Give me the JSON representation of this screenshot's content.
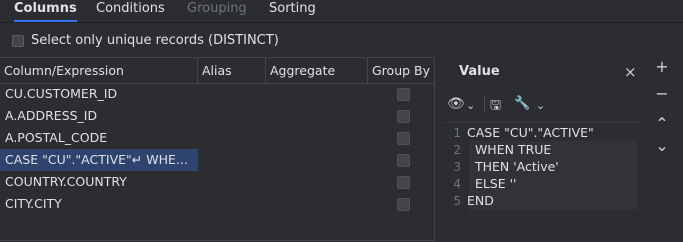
{
  "tabs": [
    {
      "label": "Columns",
      "state": "active"
    },
    {
      "label": "Conditions",
      "state": "normal"
    },
    {
      "label": "Grouping",
      "state": "disabled"
    },
    {
      "label": "Sorting",
      "state": "normal"
    }
  ],
  "distinct": {
    "label": "Select only unique records (DISTINCT)",
    "checked": false
  },
  "grid": {
    "headers": [
      "Column/Expression",
      "Alias",
      "Aggregate",
      "Group By"
    ],
    "rows": [
      {
        "expression": "CU.CUSTOMER_ID",
        "selected": false
      },
      {
        "expression": "A.ADDRESS_ID",
        "selected": false
      },
      {
        "expression": "A.POSTAL_CODE",
        "selected": false
      },
      {
        "expression": "CASE \"CU\".\"ACTIVE\"↵   WHE...",
        "selected": true
      },
      {
        "expression": "COUNTRY.COUNTRY",
        "selected": false
      },
      {
        "expression": "CITY.CITY",
        "selected": false
      }
    ]
  },
  "value_panel": {
    "title": "Value",
    "close_icon": "×",
    "toolbar": {
      "eye_icon": "👁",
      "chevron": "⌄",
      "save_icon": "🖫",
      "wrench_icon": "🔧"
    },
    "lines": [
      {
        "num": "1",
        "text": "CASE \"CU\".\"ACTIVE\""
      },
      {
        "num": "2",
        "text": "  WHEN TRUE"
      },
      {
        "num": "3",
        "text": "  THEN 'Active'"
      },
      {
        "num": "4",
        "text": "  ELSE ''"
      },
      {
        "num": "5",
        "text": "END"
      }
    ]
  },
  "side_buttons": {
    "add": "+",
    "remove": "−",
    "up": "⌃",
    "down": "⌄"
  },
  "colors": {
    "background": "#2b2d30",
    "selection": "#2e436e",
    "accent": "#3574f0"
  }
}
